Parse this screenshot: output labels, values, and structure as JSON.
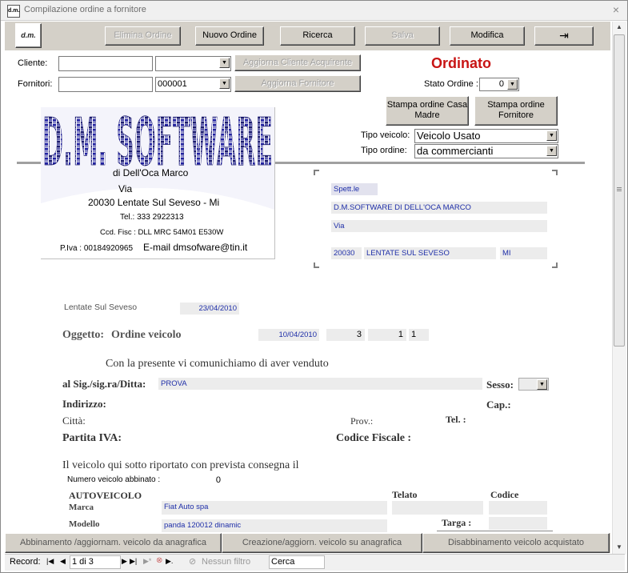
{
  "window": {
    "title": "Compilazione ordine a fornitore",
    "app_icon": "d.m.",
    "close_glyph": "×"
  },
  "toolbar": {
    "logo_label": "d.m.",
    "elimina": "Elimina Ordine",
    "nuovo": "Nuovo Ordine",
    "ricerca": "Ricerca",
    "salva": "Salva",
    "modifica": "Modifica",
    "exit_glyph": "⇥"
  },
  "header": {
    "cliente_label": "Cliente:",
    "cliente_value": "",
    "cliente_combo": "",
    "fornitori_label": "Fornitori:",
    "fornitori_value": "",
    "fornitori_combo": "000001",
    "aggiorna_cliente": "Aggiorna Cliente Acquirente",
    "aggiorna_fornitore": "Aggiorna Fornitore",
    "status_title": "Ordinato",
    "stato_label": "Stato Ordine :",
    "stato_value": "0",
    "stampa_casa": "Stampa ordine Casa Madre",
    "stampa_fornitore": "Stampa ordine Fornitore",
    "tipo_veicolo_label": "Tipo veicolo:",
    "tipo_veicolo_value": "Veicolo Usato",
    "tipo_ordine_label": "Tipo ordine:",
    "tipo_ordine_value": "da commercianti"
  },
  "logo": {
    "brand": "D.M. SOFTWARE",
    "owner": "di Dell'Oca Marco",
    "via": "Via",
    "city": "20030  Lentate Sul Seveso - Mi",
    "tel": "Tel.: 333 2922313",
    "cf": "Ccd. Fisc : DLL MRC 54M01 E530W",
    "piva": "P.Iva : 00184920965",
    "email": "E-mail dmsofware@tin.it"
  },
  "recipient": {
    "spett": "Spett.le",
    "company": "D.M.SOFTWARE DI DELL'OCA MARCO",
    "via": "Via",
    "cap": "20030",
    "city": "LENTATE SUL SEVESO",
    "prov": "MI"
  },
  "letter": {
    "place": "Lentate Sul Seveso",
    "date": "23/04/2010",
    "oggetto_label": "Oggetto:",
    "oggetto_text": "Ordine veicolo",
    "oggetto_field1": "",
    "oggetto_date": "10/04/2010",
    "oggetto_num": "3",
    "oggetto_a": "1",
    "oggetto_b": "1",
    "intro": "Con la presente vi comunichiamo di aver venduto",
    "sig_label": "al Sig./sig.ra/Ditta:",
    "sig_value": "PROVA",
    "sesso_label": "Sesso:",
    "indirizzo_label": "Indirizzo:",
    "cap_label": "Cap.:",
    "citta_label": "Città:",
    "prov_label": "Prov.:",
    "tel_label": "Tel. :",
    "piva_label": "Partita IVA:",
    "cf_label": "Codice Fiscale :",
    "consegna": "Il veicolo qui sotto riportato con prevista consegna il",
    "numero_label": "Numero veicolo abbinato :",
    "numero_value": "0",
    "auto_label": "AUTOVEICOLO",
    "telaio_label": "Telato",
    "codice_label": "Codice",
    "marca_label": "Marca",
    "marca_value": "Fiat Auto spa",
    "modello_label": "Modello",
    "modello_value": "panda 120012 dinamic",
    "targa_label": "Targa :"
  },
  "bottom": {
    "b1": "Abbinamento /aggiornam. veicolo da anagrafica",
    "b2": "Creazione/aggiorn. veicolo su anagrafica",
    "b3": "Disabbinamento veicolo acquistato"
  },
  "nav": {
    "record_label": "Record:",
    "position": "1 di 3",
    "filter": "Nessun filtro",
    "search": "Cerca"
  }
}
